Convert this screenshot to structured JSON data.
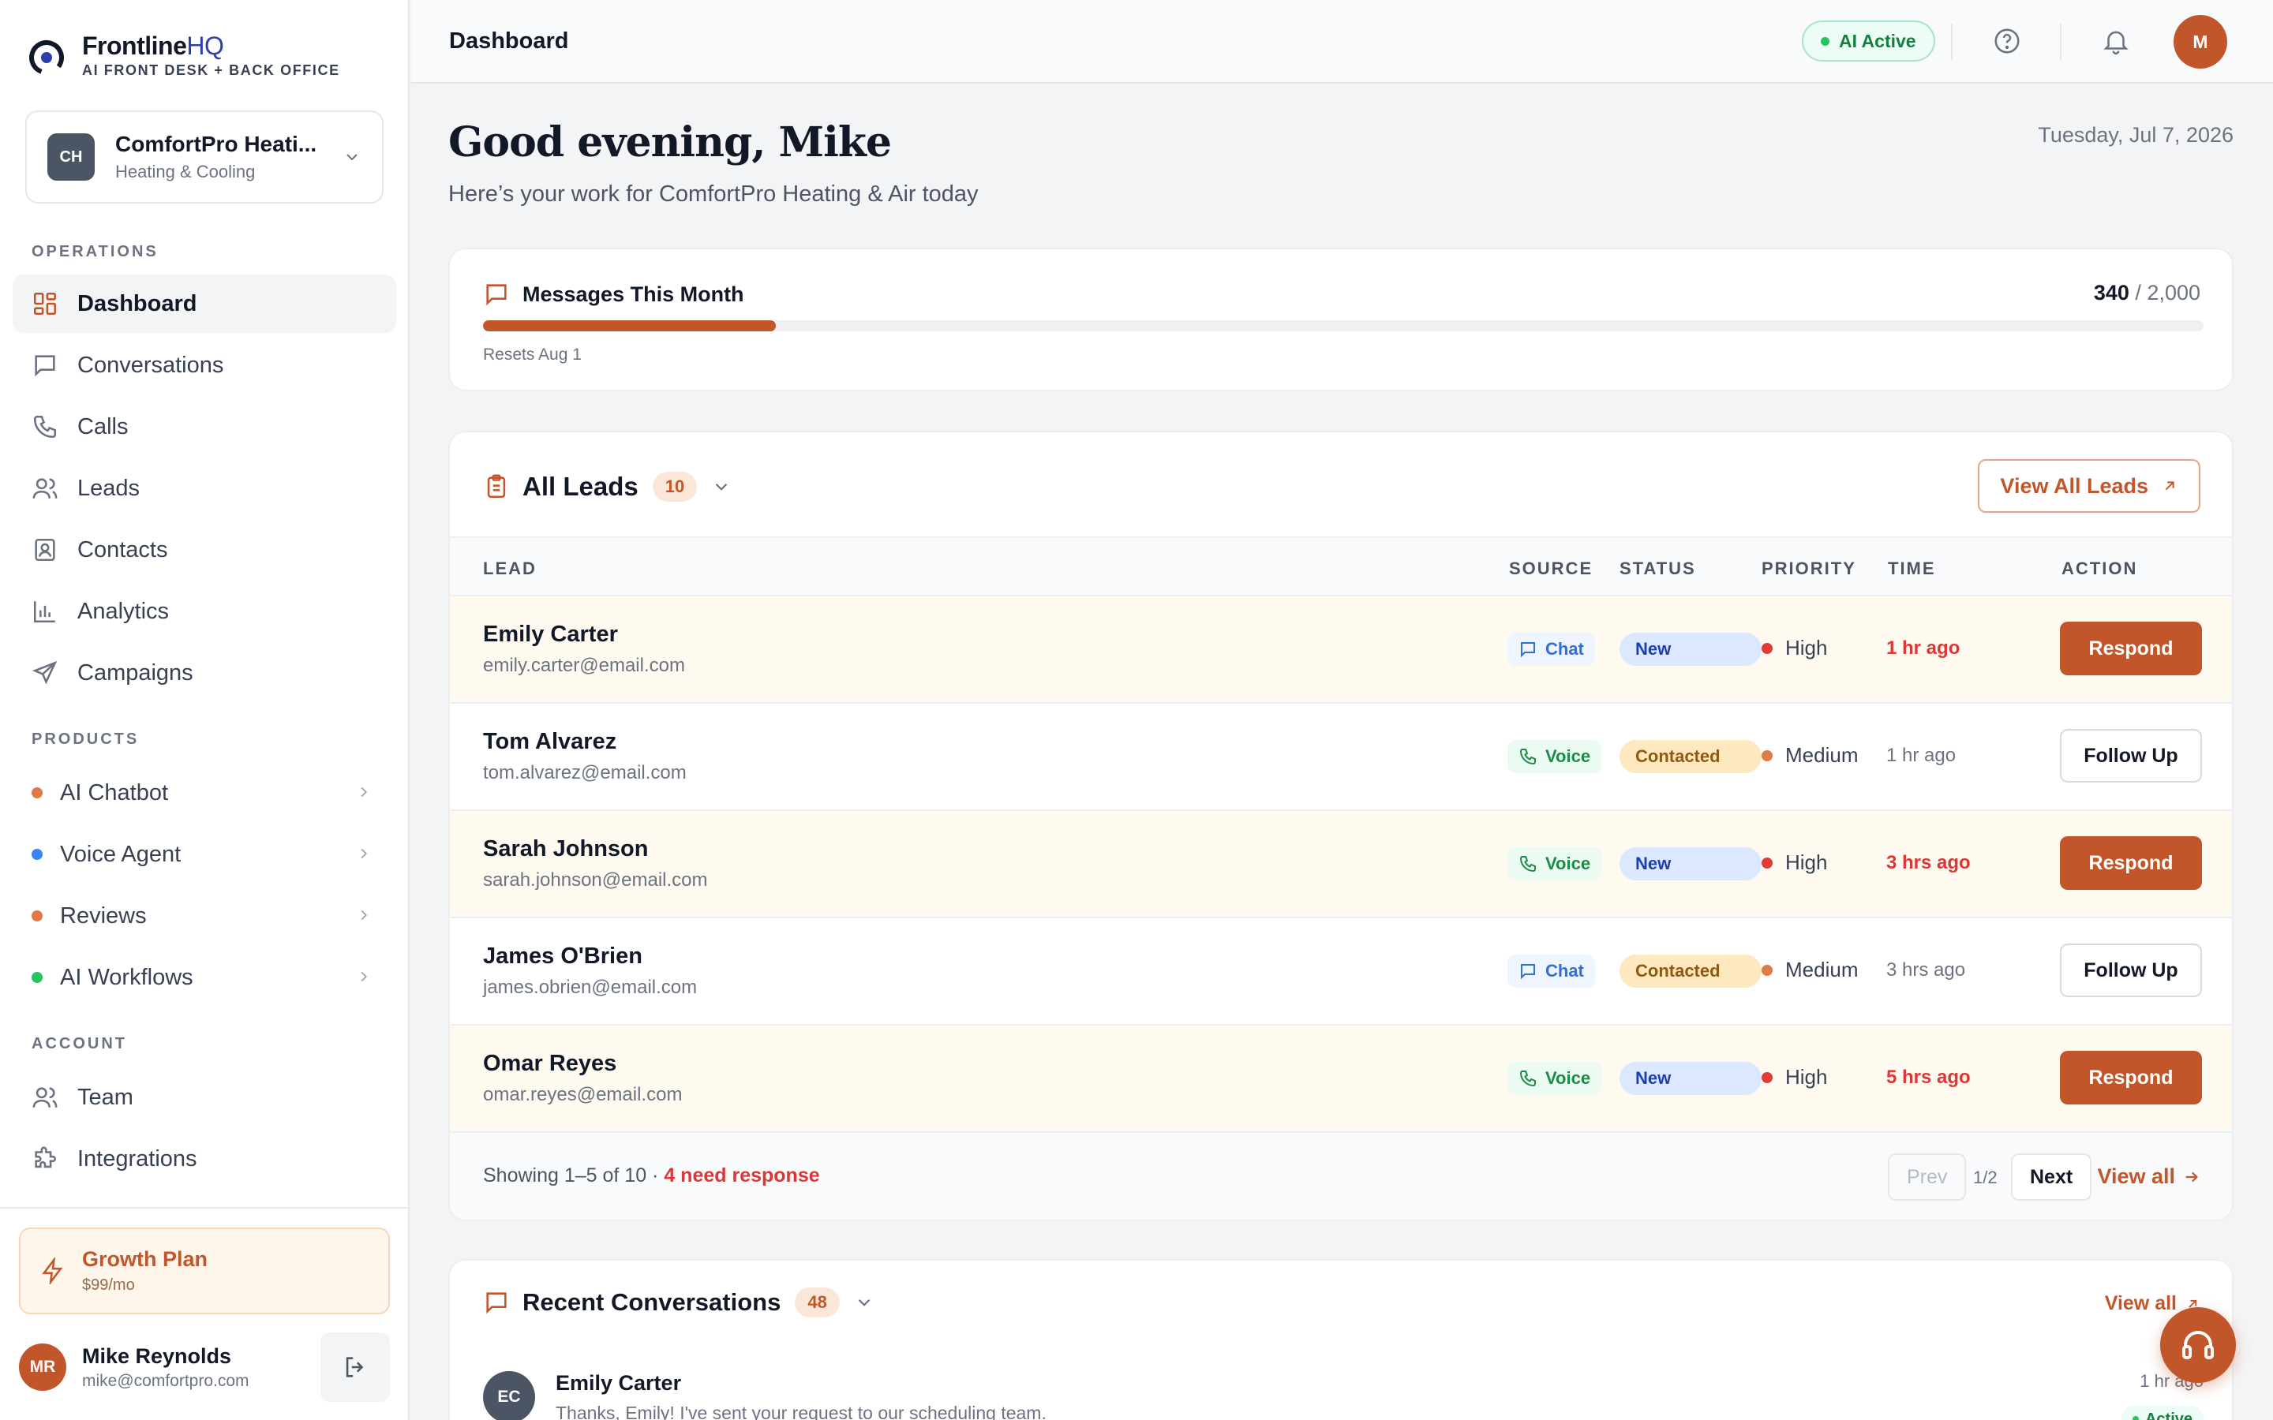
{
  "brand": {
    "name_main": "Frontline",
    "name_accent": "HQ",
    "tagline": "AI FRONT DESK + BACK OFFICE"
  },
  "org": {
    "initials": "CH",
    "name": "ComfortPro Heati...",
    "category": "Heating & Cooling"
  },
  "sidebar": {
    "operations_label": "OPERATIONS",
    "operations": [
      {
        "label": "Dashboard",
        "icon": "grid-icon"
      },
      {
        "label": "Conversations",
        "icon": "chat-icon"
      },
      {
        "label": "Calls",
        "icon": "phone-icon"
      },
      {
        "label": "Leads",
        "icon": "users-icon"
      },
      {
        "label": "Contacts",
        "icon": "contact-card-icon"
      },
      {
        "label": "Analytics",
        "icon": "bar-chart-icon"
      },
      {
        "label": "Campaigns",
        "icon": "send-icon"
      }
    ],
    "products_label": "PRODUCTS",
    "products": [
      {
        "label": "AI Chatbot",
        "color": "#e07a47"
      },
      {
        "label": "Voice Agent",
        "color": "#3b82f6"
      },
      {
        "label": "Reviews",
        "color": "#e07a47"
      },
      {
        "label": "AI Workflows",
        "color": "#22c55e"
      }
    ],
    "account_label": "ACCOUNT",
    "account": [
      {
        "label": "Team",
        "icon": "users-icon"
      },
      {
        "label": "Integrations",
        "icon": "puzzle-icon"
      }
    ],
    "plan": {
      "name": "Growth Plan",
      "price": "$99/mo"
    },
    "user": {
      "initials": "MR",
      "name": "Mike Reynolds",
      "email": "mike@comfortpro.com"
    }
  },
  "topbar": {
    "title": "Dashboard",
    "ai_status": "AI Active",
    "avatar_initial": "M"
  },
  "header": {
    "greeting": "Good evening, Mike",
    "subtitle": "Here’s your work for ComfortPro Heating & Air today",
    "date": "Tuesday, Jul 7, 2026"
  },
  "messages": {
    "title": "Messages This Month",
    "used": "340",
    "limit": "/ 2,000",
    "progress": 0.17,
    "reset": "Resets Aug 1"
  },
  "leads": {
    "title": "All Leads",
    "count": "10",
    "view_all": "View All Leads",
    "columns": [
      "LEAD",
      "SOURCE",
      "STATUS",
      "PRIORITY",
      "TIME",
      "ACTION"
    ],
    "rows": [
      {
        "name": "Emily Carter",
        "email": "emily.carter@email.com",
        "source": "Chat",
        "status": "New",
        "priority": "High",
        "time": "1 hr ago",
        "action": "Respond"
      },
      {
        "name": "Tom Alvarez",
        "email": "tom.alvarez@email.com",
        "source": "Voice",
        "status": "Contacted",
        "priority": "Medium",
        "time": "1 hr ago",
        "action": "Follow Up"
      },
      {
        "name": "Sarah Johnson",
        "email": "sarah.johnson@email.com",
        "source": "Voice",
        "status": "New",
        "priority": "High",
        "time": "3 hrs ago",
        "action": "Respond"
      },
      {
        "name": "James O'Brien",
        "email": "james.obrien@email.com",
        "source": "Chat",
        "status": "Contacted",
        "priority": "Medium",
        "time": "3 hrs ago",
        "action": "Follow Up"
      },
      {
        "name": "Omar Reyes",
        "email": "omar.reyes@email.com",
        "source": "Voice",
        "status": "New",
        "priority": "High",
        "time": "5 hrs ago",
        "action": "Respond"
      }
    ],
    "footer": {
      "showing": "Showing 1–5 of 10 · ",
      "need_response": "4 need response",
      "prev": "Prev",
      "page": "1/2",
      "next": "Next",
      "view_all": "View all"
    }
  },
  "conversations": {
    "title": "Recent Conversations",
    "count": "48",
    "view_all": "View all",
    "items": [
      {
        "initials": "EC",
        "name": "Emily Carter",
        "message": "Thanks, Emily! I've sent your request to our scheduling team.",
        "time": "1 hr ago",
        "status": "Active"
      }
    ]
  },
  "colors": {
    "accent": "#c2562b",
    "high": "#e23b3b",
    "medium": "#e07a47"
  }
}
